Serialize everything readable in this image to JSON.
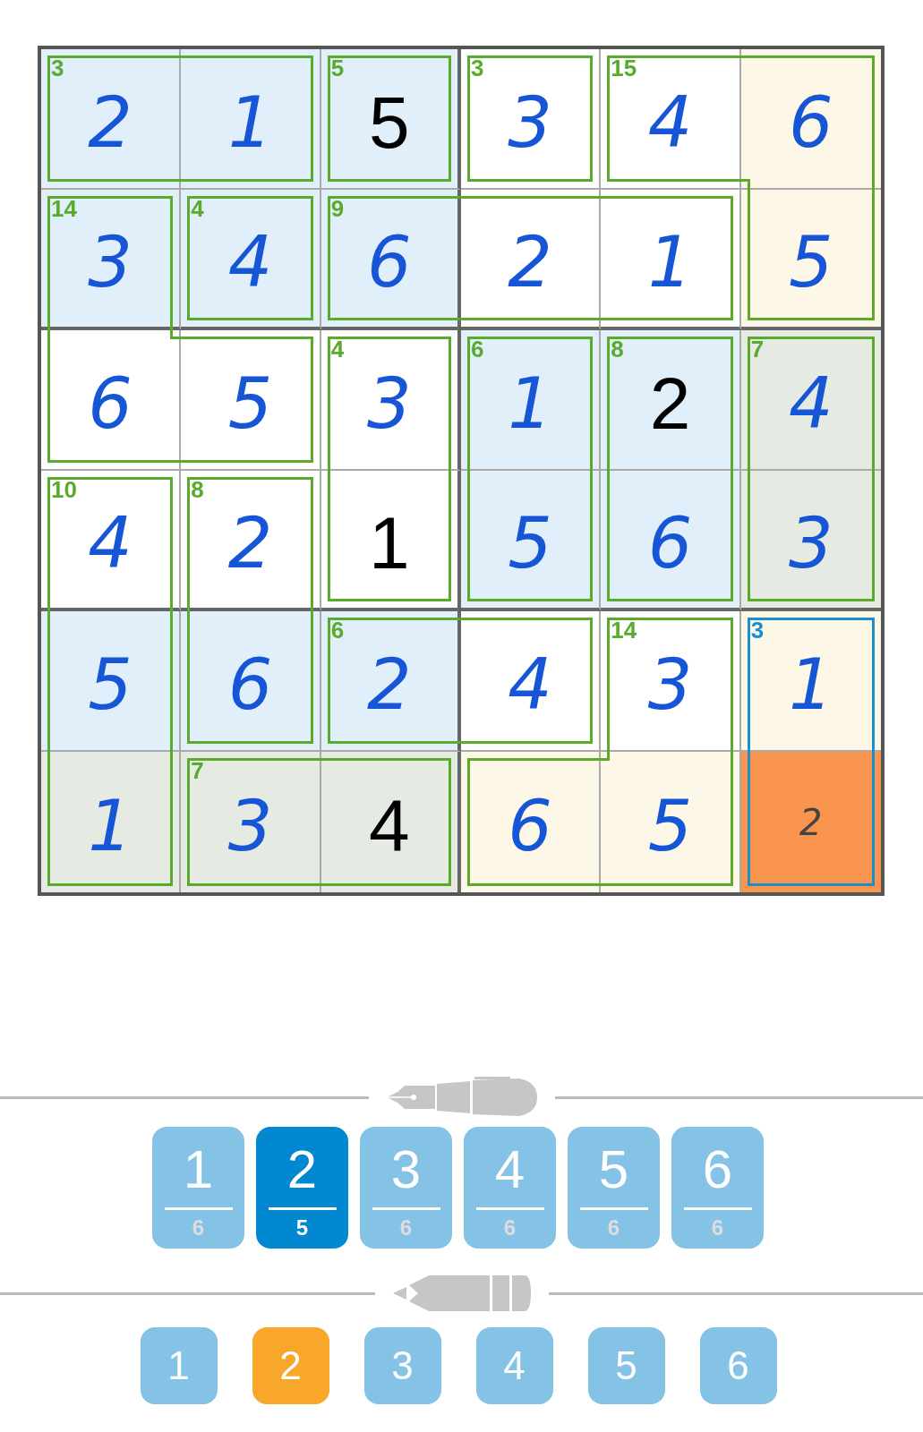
{
  "grid": {
    "rows": [
      {
        "cells": [
          {
            "value": "2",
            "given": false,
            "color": "#e1effa",
            "selected": false,
            "sum": "3",
            "cage_selected": false,
            "edges": {
              "top": true,
              "right": false,
              "bottom": true,
              "left": true
            }
          },
          {
            "value": "1",
            "given": false,
            "color": "#e1effa",
            "selected": false,
            "cage_selected": false,
            "edges": {
              "top": true,
              "right": true,
              "bottom": true,
              "left": false
            }
          },
          {
            "value": "5",
            "given": true,
            "color": "#e1effa",
            "selected": false,
            "sum": "5",
            "cage_selected": false,
            "edges": {
              "top": true,
              "right": true,
              "bottom": true,
              "left": true
            }
          },
          {
            "value": "3",
            "given": false,
            "color": "#ffffff",
            "selected": false,
            "sum": "3",
            "cage_selected": false,
            "edges": {
              "top": true,
              "right": true,
              "bottom": true,
              "left": true
            }
          },
          {
            "value": "4",
            "given": false,
            "color": "#ffffff",
            "selected": false,
            "sum": "15",
            "cage_selected": false,
            "edges": {
              "top": true,
              "right": false,
              "bottom": true,
              "left": true
            }
          },
          {
            "value": "6",
            "given": false,
            "color": "#fdf7e7",
            "selected": false,
            "cage_selected": false,
            "edges": {
              "top": true,
              "right": true,
              "bottom": false,
              "left": false
            }
          }
        ]
      },
      {
        "cells": [
          {
            "value": "3",
            "given": false,
            "color": "#e1effa",
            "selected": false,
            "sum": "14",
            "cage_selected": false,
            "edges": {
              "top": true,
              "right": true,
              "bottom": false,
              "left": true
            }
          },
          {
            "value": "4",
            "given": false,
            "color": "#e1effa",
            "selected": false,
            "sum": "4",
            "cage_selected": false,
            "edges": {
              "top": true,
              "right": true,
              "bottom": true,
              "left": true
            }
          },
          {
            "value": "6",
            "given": false,
            "color": "#e1effa",
            "selected": false,
            "sum": "9",
            "cage_selected": false,
            "edges": {
              "top": true,
              "right": false,
              "bottom": true,
              "left": true
            }
          },
          {
            "value": "2",
            "given": false,
            "color": "#ffffff",
            "selected": false,
            "cage_selected": false,
            "edges": {
              "top": true,
              "right": false,
              "bottom": true,
              "left": false
            }
          },
          {
            "value": "1",
            "given": false,
            "color": "#ffffff",
            "selected": false,
            "cage_selected": false,
            "edges": {
              "top": true,
              "right": true,
              "bottom": true,
              "left": false
            }
          },
          {
            "value": "5",
            "given": false,
            "color": "#fdf7e7",
            "selected": false,
            "cage_selected": false,
            "edges": {
              "top": false,
              "right": true,
              "bottom": true,
              "left": true
            }
          }
        ]
      },
      {
        "cells": [
          {
            "value": "6",
            "given": false,
            "color": "#ffffff",
            "selected": false,
            "cage_selected": false,
            "edges": {
              "top": false,
              "right": false,
              "bottom": true,
              "left": true
            }
          },
          {
            "value": "5",
            "given": false,
            "color": "#ffffff",
            "selected": false,
            "cage_selected": false,
            "edges": {
              "top": true,
              "right": true,
              "bottom": true,
              "left": false
            }
          },
          {
            "value": "3",
            "given": false,
            "color": "#ffffff",
            "selected": false,
            "sum": "4",
            "cage_selected": false,
            "edges": {
              "top": true,
              "right": true,
              "bottom": false,
              "left": true
            }
          },
          {
            "value": "1",
            "given": false,
            "color": "#e1effa",
            "selected": false,
            "sum": "6",
            "cage_selected": false,
            "edges": {
              "top": true,
              "right": true,
              "bottom": false,
              "left": true
            }
          },
          {
            "value": "2",
            "given": true,
            "color": "#e1effa",
            "selected": false,
            "sum": "8",
            "cage_selected": false,
            "edges": {
              "top": true,
              "right": true,
              "bottom": false,
              "left": true
            }
          },
          {
            "value": "4",
            "given": false,
            "color": "#e5ebe3",
            "selected": false,
            "sum": "7",
            "cage_selected": false,
            "edges": {
              "top": true,
              "right": true,
              "bottom": false,
              "left": true
            }
          }
        ]
      },
      {
        "cells": [
          {
            "value": "4",
            "given": false,
            "color": "#ffffff",
            "selected": false,
            "sum": "10",
            "cage_selected": false,
            "edges": {
              "top": true,
              "right": true,
              "bottom": false,
              "left": true
            }
          },
          {
            "value": "2",
            "given": false,
            "color": "#ffffff",
            "selected": false,
            "sum": "8",
            "cage_selected": false,
            "edges": {
              "top": true,
              "right": true,
              "bottom": false,
              "left": true
            }
          },
          {
            "value": "1",
            "given": true,
            "color": "#ffffff",
            "selected": false,
            "cage_selected": false,
            "edges": {
              "top": false,
              "right": true,
              "bottom": true,
              "left": true
            }
          },
          {
            "value": "5",
            "given": false,
            "color": "#e1effa",
            "selected": false,
            "cage_selected": false,
            "edges": {
              "top": false,
              "right": true,
              "bottom": true,
              "left": true
            }
          },
          {
            "value": "6",
            "given": false,
            "color": "#e1effa",
            "selected": false,
            "cage_selected": false,
            "edges": {
              "top": false,
              "right": true,
              "bottom": true,
              "left": true
            }
          },
          {
            "value": "3",
            "given": false,
            "color": "#e5ebe3",
            "selected": false,
            "cage_selected": false,
            "edges": {
              "top": false,
              "right": true,
              "bottom": true,
              "left": true
            }
          }
        ]
      },
      {
        "cells": [
          {
            "value": "5",
            "given": false,
            "color": "#e1effa",
            "selected": false,
            "cage_selected": false,
            "edges": {
              "top": false,
              "right": true,
              "bottom": false,
              "left": true
            }
          },
          {
            "value": "6",
            "given": false,
            "color": "#e1effa",
            "selected": false,
            "cage_selected": false,
            "edges": {
              "top": false,
              "right": true,
              "bottom": true,
              "left": true
            }
          },
          {
            "value": "2",
            "given": false,
            "color": "#e1effa",
            "selected": false,
            "sum": "6",
            "cage_selected": false,
            "edges": {
              "top": true,
              "right": false,
              "bottom": true,
              "left": true
            }
          },
          {
            "value": "4",
            "given": false,
            "color": "#ffffff",
            "selected": false,
            "cage_selected": false,
            "edges": {
              "top": true,
              "right": true,
              "bottom": true,
              "left": false
            }
          },
          {
            "value": "3",
            "given": false,
            "color": "#ffffff",
            "selected": false,
            "sum": "14",
            "cage_selected": false,
            "edges": {
              "top": true,
              "right": true,
              "bottom": false,
              "left": true
            }
          },
          {
            "value": "1",
            "given": false,
            "color": "#fdf7e7",
            "selected": false,
            "sum": "3",
            "cage_selected": true,
            "edges": {
              "top": true,
              "right": true,
              "bottom": false,
              "left": true
            }
          }
        ]
      },
      {
        "cells": [
          {
            "value": "1",
            "given": false,
            "color": "#e5ebe3",
            "selected": false,
            "cage_selected": false,
            "edges": {
              "top": false,
              "right": true,
              "bottom": true,
              "left": true
            }
          },
          {
            "value": "3",
            "given": false,
            "color": "#e5ebe3",
            "selected": false,
            "sum": "7",
            "cage_selected": false,
            "edges": {
              "top": true,
              "right": false,
              "bottom": true,
              "left": true
            }
          },
          {
            "value": "4",
            "given": true,
            "color": "#e5ebe3",
            "selected": false,
            "cage_selected": false,
            "edges": {
              "top": true,
              "right": true,
              "bottom": true,
              "left": false
            }
          },
          {
            "value": "6",
            "given": false,
            "color": "#fdf7e7",
            "selected": false,
            "cage_selected": false,
            "edges": {
              "top": true,
              "right": false,
              "bottom": true,
              "left": true
            }
          },
          {
            "value": "5",
            "given": false,
            "color": "#fdf7e7",
            "selected": false,
            "cage_selected": false,
            "edges": {
              "top": false,
              "right": true,
              "bottom": true,
              "left": false
            }
          },
          {
            "notes": "2",
            "selected": true,
            "cage_selected": true,
            "edges": {
              "top": false,
              "right": true,
              "bottom": true,
              "left": true
            }
          }
        ]
      }
    ]
  },
  "pen_pad": {
    "buttons": [
      {
        "digit": "1",
        "count": "6",
        "selected": false
      },
      {
        "digit": "2",
        "count": "5",
        "selected": true
      },
      {
        "digit": "3",
        "count": "6",
        "selected": false
      },
      {
        "digit": "4",
        "count": "6",
        "selected": false
      },
      {
        "digit": "5",
        "count": "6",
        "selected": false
      },
      {
        "digit": "6",
        "count": "6",
        "selected": false
      }
    ]
  },
  "pencil_pad": {
    "buttons": [
      {
        "digit": "1",
        "selected": false
      },
      {
        "digit": "2",
        "selected": true
      },
      {
        "digit": "3",
        "selected": false
      },
      {
        "digit": "4",
        "selected": false
      },
      {
        "digit": "5",
        "selected": false
      },
      {
        "digit": "6",
        "selected": false
      }
    ]
  }
}
